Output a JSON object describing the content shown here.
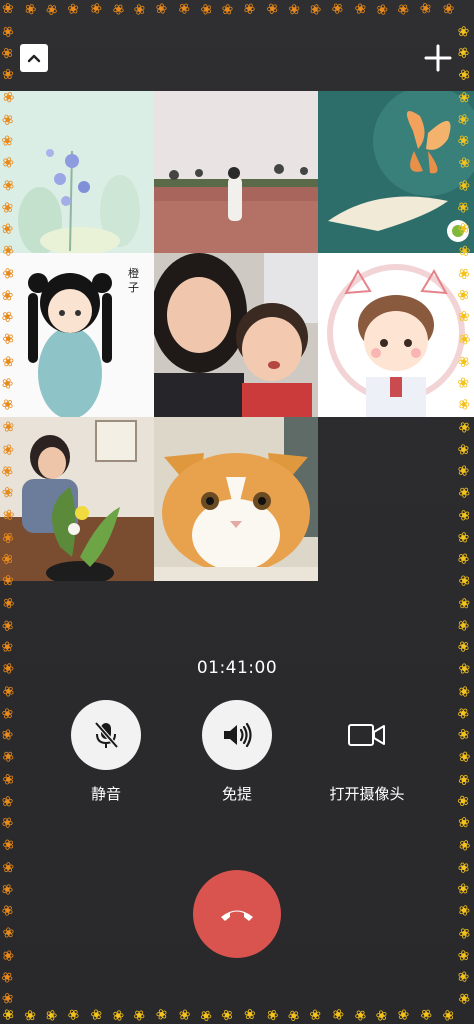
{
  "call": {
    "timer": "01:41:00"
  },
  "topbar": {
    "collapse_icon": "chevron-up-icon",
    "add_icon": "plus-icon"
  },
  "participants": [
    {
      "name": "participant-1",
      "avatar": "flowers-illustration"
    },
    {
      "name": "participant-2",
      "avatar": "field-photo"
    },
    {
      "name": "participant-3",
      "avatar": "butterfly-hand-art"
    },
    {
      "name": "participant-4",
      "avatar": "anime-girl-drawing"
    },
    {
      "name": "participant-5",
      "avatar": "mother-child-selfie"
    },
    {
      "name": "participant-6",
      "avatar": "cartoon-boy-cat-ears"
    },
    {
      "name": "participant-7",
      "avatar": "woman-flower-arranging"
    },
    {
      "name": "participant-8",
      "avatar": "orange-cat-photo"
    }
  ],
  "controls": {
    "mute_label": "静音",
    "speaker_label": "免提",
    "camera_label": "打开摄像头"
  },
  "colors": {
    "background": "#2b2b2d",
    "hangup": "#d9534f",
    "control_circle": "#f2f2f2",
    "leaf_orange": "#e8891a",
    "leaf_yellow": "#f5c21b"
  }
}
